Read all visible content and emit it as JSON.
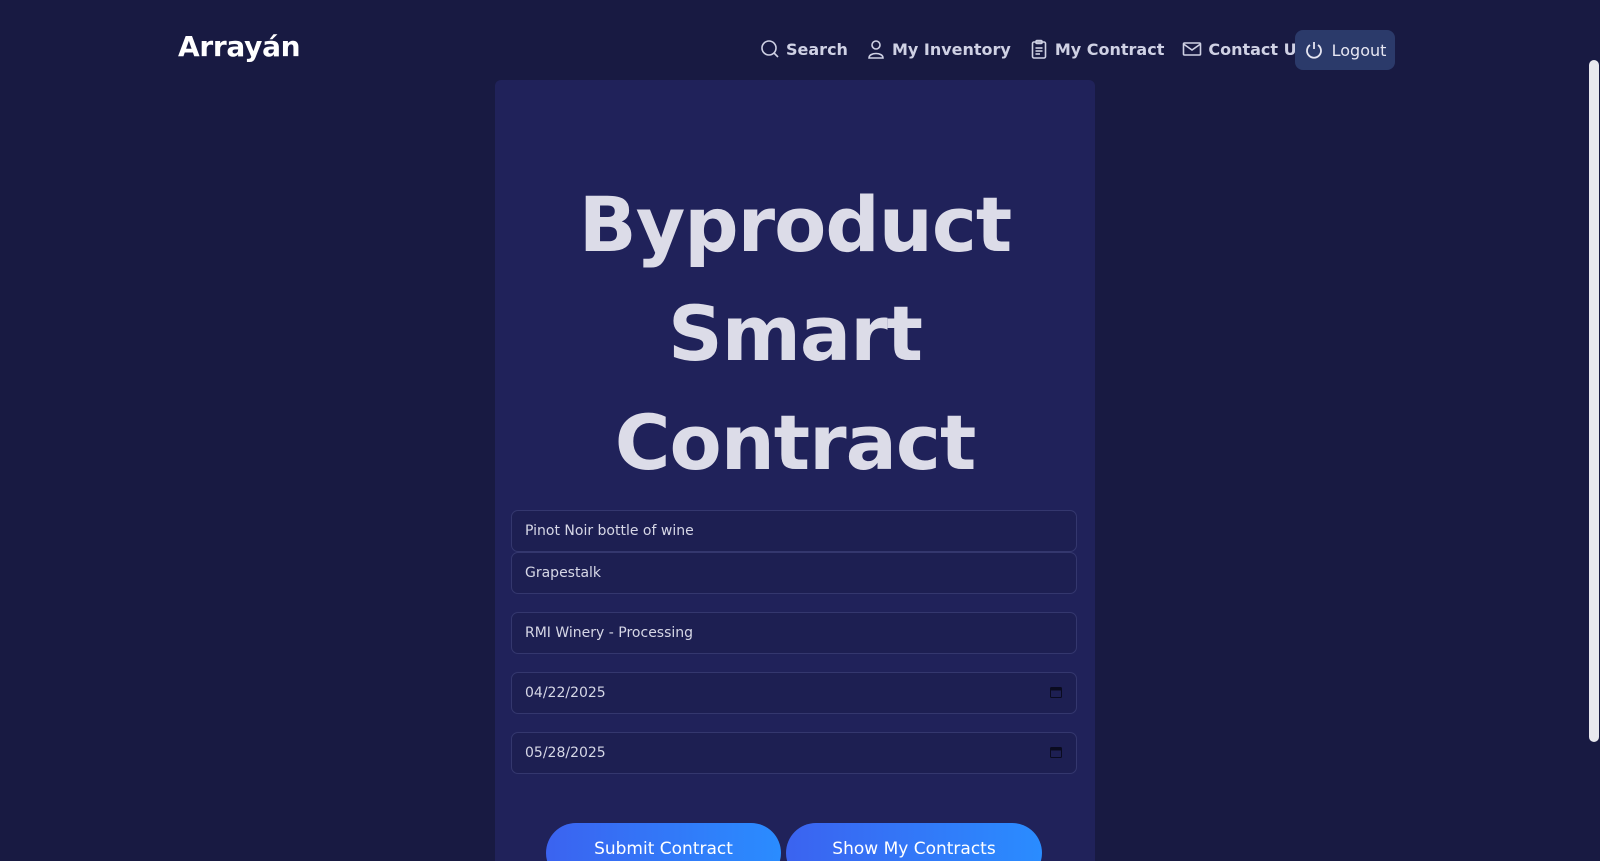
{
  "header": {
    "brand": "Arrayán",
    "nav": [
      {
        "label": "Search",
        "icon": "search-icon"
      },
      {
        "label": "My Inventory",
        "icon": "user-icon"
      },
      {
        "label": "My Contract",
        "icon": "clipboard-icon"
      },
      {
        "label": "Contact Us",
        "icon": "mail-icon"
      }
    ],
    "logout_label": "Logout"
  },
  "card": {
    "title_lines": [
      "Byproduct",
      "Smart",
      "Contract"
    ],
    "fields": {
      "product": "Pinot Noir bottle of wine",
      "byproduct": "Grapestalk",
      "facility": "RMI Winery - Processing",
      "start_date": "04/22/2025",
      "end_date": "05/28/2025"
    },
    "submit_label": "Submit Contract",
    "show_label": "Show My Contracts"
  },
  "colors": {
    "background": "#181a42",
    "card": "#20225a",
    "button_gradient_start": "#3b63f0",
    "button_gradient_end": "#2a8cff",
    "logout_bg": "#2b3a6a"
  }
}
